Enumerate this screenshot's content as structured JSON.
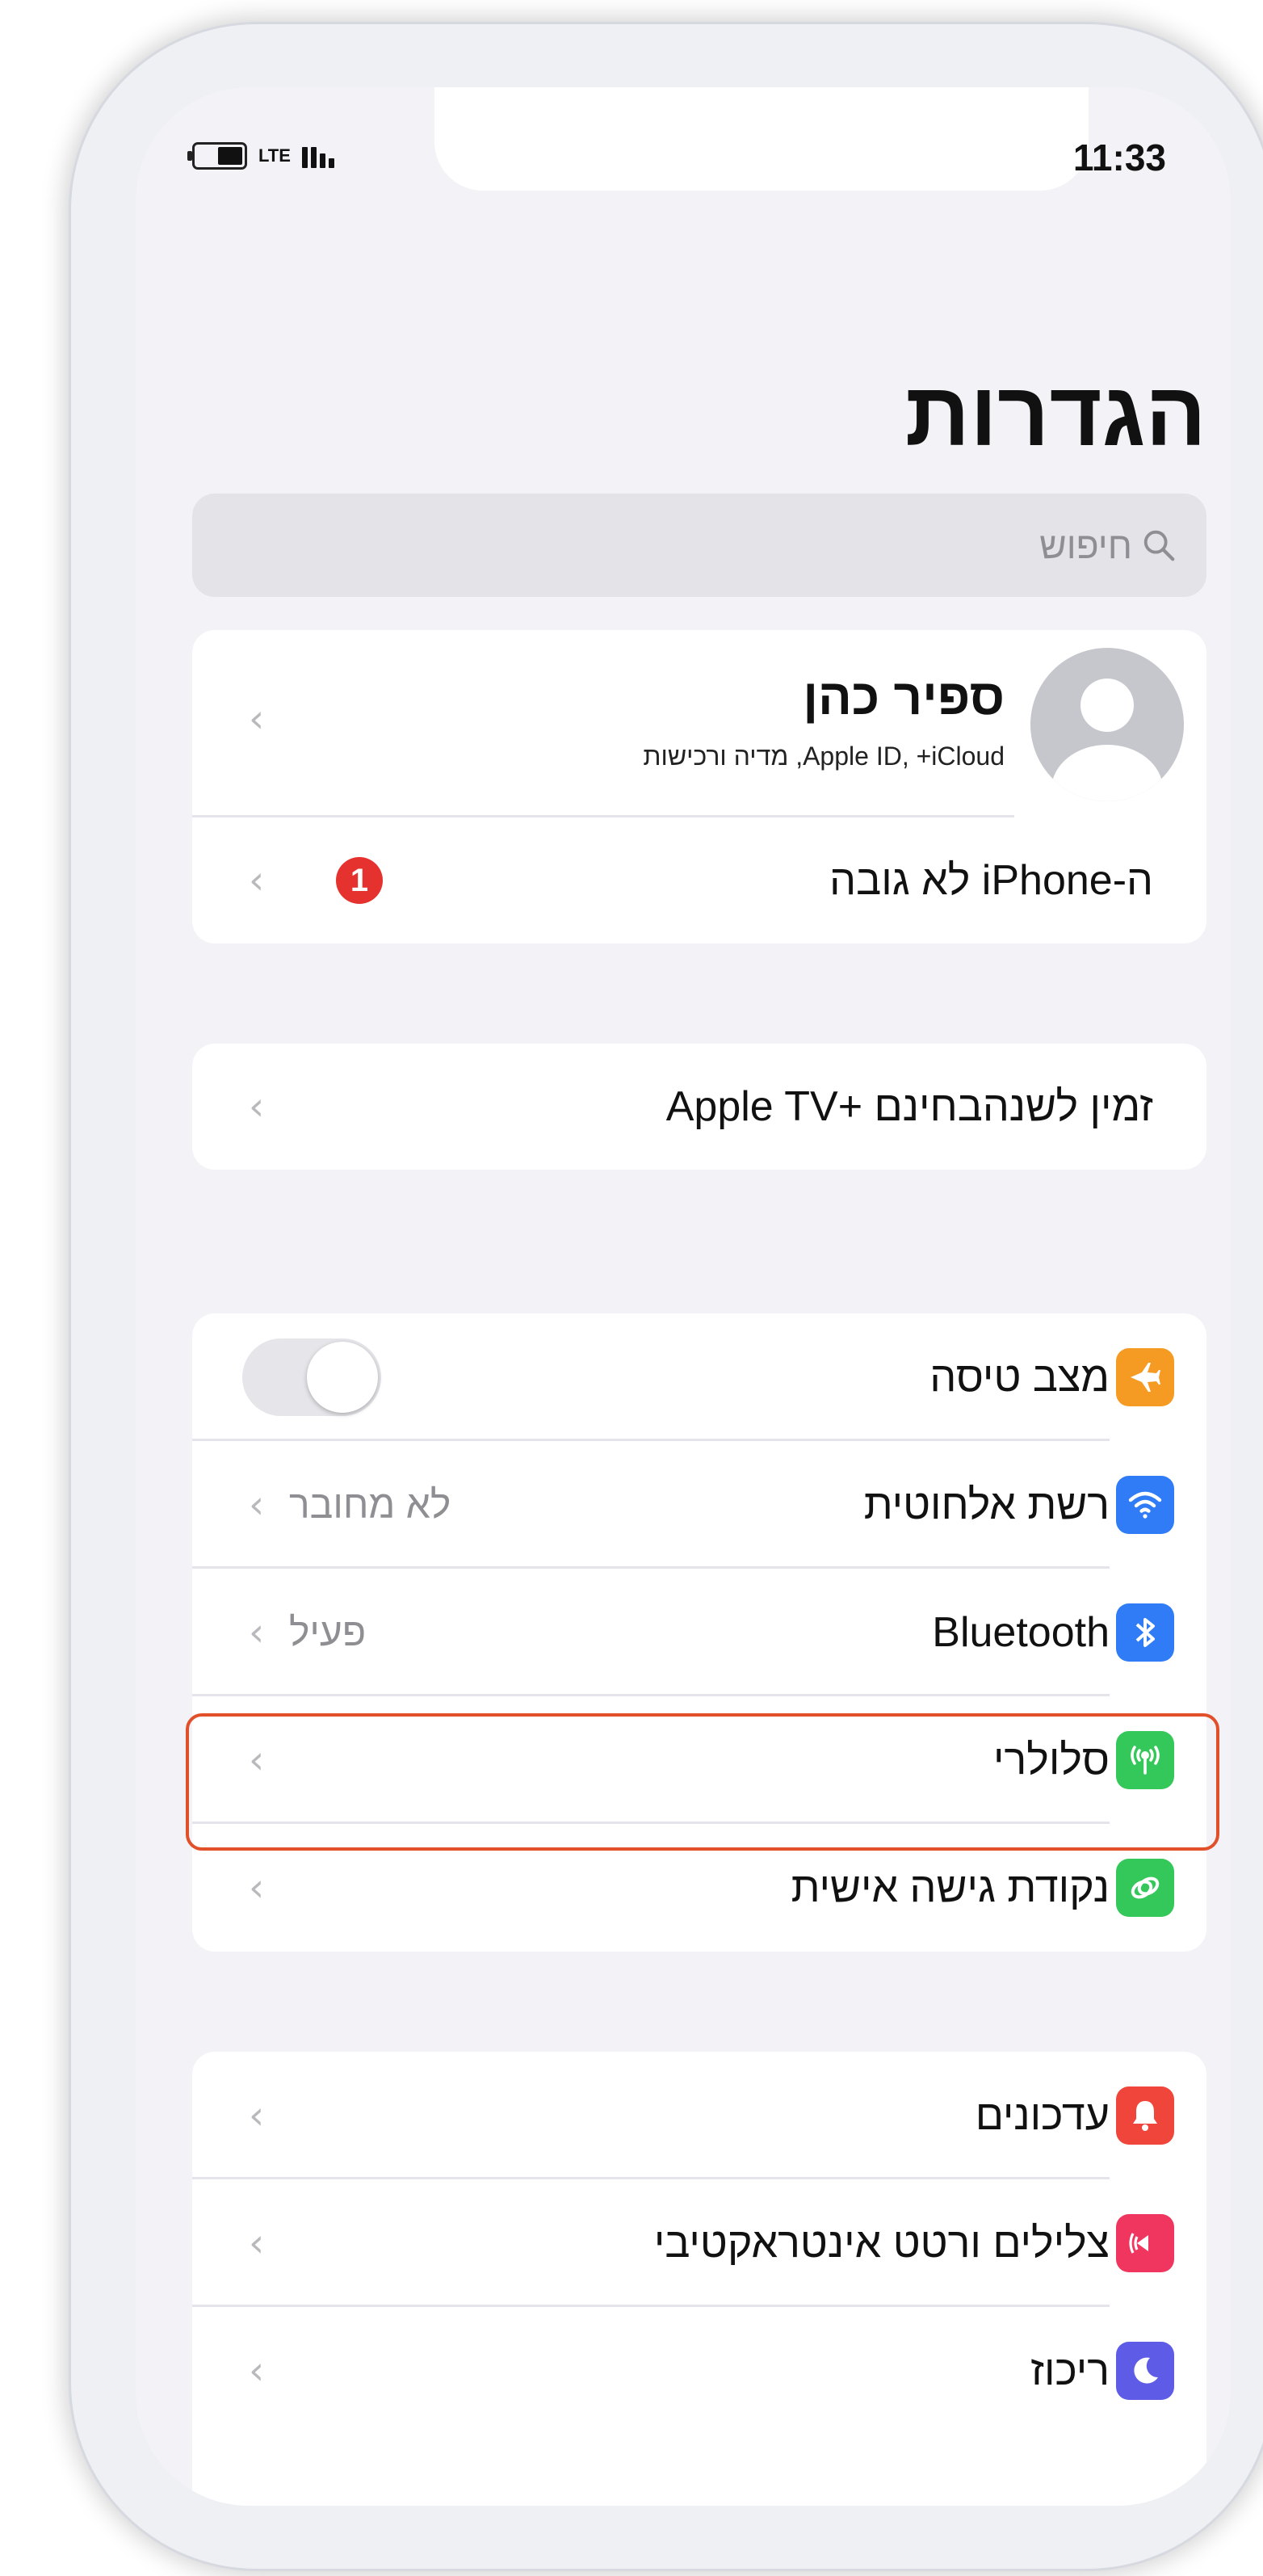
{
  "status_bar": {
    "time": "11:33",
    "network": "LTE"
  },
  "header": {
    "title": "הגדרות"
  },
  "search": {
    "placeholder": "חיפוש"
  },
  "profile": {
    "name": "ספיר כהן",
    "subtitle": "Apple ID, ‎+iCloud, מדיה ורכישות"
  },
  "backup": {
    "label": "ה-iPhone לא גובה",
    "badge": "1"
  },
  "promo": {
    "label": "זמין לשנהבחינם +Apple TV"
  },
  "connectivity": [
    {
      "label": "מצב טיסה",
      "icon": "airplane-icon",
      "color": "#f59a23",
      "control": "toggle",
      "state": "off"
    },
    {
      "label": "רשת אלחוטית",
      "icon": "wifi-icon",
      "color": "#2f7cf6",
      "value": "לא מחובר"
    },
    {
      "label": "Bluetooth",
      "icon": "bluetooth-icon",
      "color": "#2f7cf6",
      "value": "פעיל"
    },
    {
      "label": "סלולרי",
      "icon": "cellular-icon",
      "color": "#34c759",
      "highlighted": true
    },
    {
      "label": "נקודת גישה אישית",
      "icon": "hotspot-icon",
      "color": "#34c759"
    }
  ],
  "notifications": [
    {
      "label": "עדכונים",
      "icon": "bell-icon",
      "color": "#f0453a"
    },
    {
      "label": "צלילים ורטט אינטראקטיבי",
      "icon": "sound-icon",
      "color": "#f0365f"
    },
    {
      "label": "ריכוז",
      "icon": "moon-icon",
      "color": "#5e5ce6"
    }
  ],
  "chevron": "‹"
}
